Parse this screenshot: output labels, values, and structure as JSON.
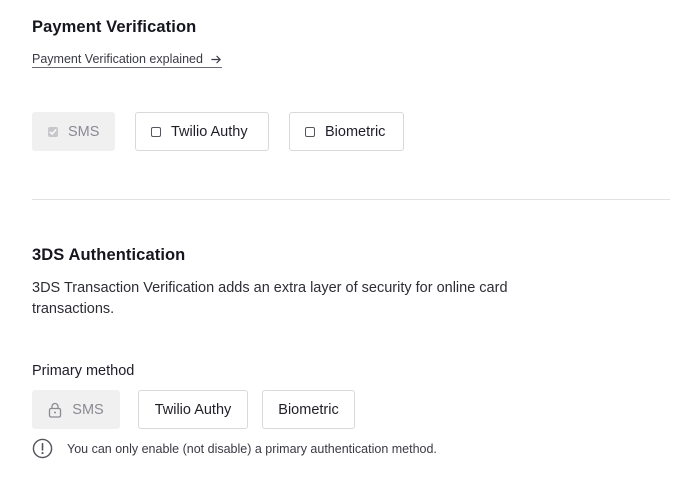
{
  "payment_verification": {
    "title": "Payment Verification",
    "explained_link": "Payment Verification explained",
    "options": [
      {
        "label": "SMS",
        "checked": true,
        "disabled": true
      },
      {
        "label": "Twilio Authy",
        "checked": false,
        "disabled": false
      },
      {
        "label": "Biometric",
        "checked": false,
        "disabled": false
      }
    ]
  },
  "three_ds": {
    "title": "3DS Authentication",
    "description": "3DS Transaction Verification adds an extra layer of security for online card transactions.",
    "primary_label": "Primary method",
    "methods": [
      {
        "label": "SMS",
        "locked": true
      },
      {
        "label": "Twilio Authy",
        "locked": false
      },
      {
        "label": "Biometric",
        "locked": false
      }
    ],
    "note": "You can only enable (not disable) a primary authentication method."
  },
  "colors": {
    "text": "#1d1d27",
    "muted": "#8a8a92",
    "disabled_bg": "#f0f0f1",
    "border": "#d9d9dd",
    "divider": "#e2e2e5"
  }
}
